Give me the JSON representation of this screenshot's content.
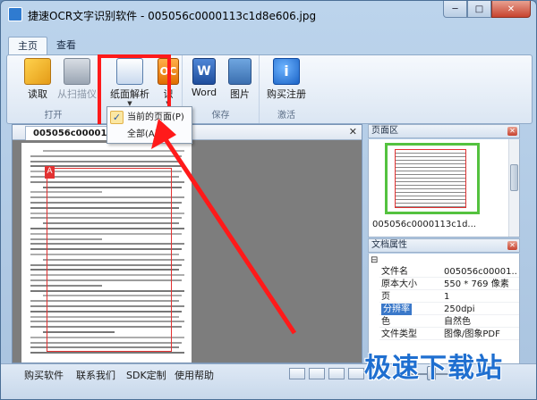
{
  "window": {
    "title": "捷速OCR文字识别软件 - 005056c0000113c1d8e606.jpg",
    "controls": {
      "min": "─",
      "max": "□",
      "close": "✕"
    }
  },
  "tabs": [
    {
      "label": "主页"
    },
    {
      "label": "查看"
    }
  ],
  "ribbon": {
    "groups": [
      {
        "label": "打开",
        "buttons": [
          {
            "label": "读取",
            "icon": "folder-icon"
          },
          {
            "label": "从扫描仪",
            "icon": "scanner-icon"
          }
        ]
      },
      {
        "label": "",
        "buttons": [
          {
            "label": "纸面解析",
            "icon": "page-analysis-icon"
          },
          {
            "label": "识",
            "icon": "ocr-icon",
            "icon_text": "OC"
          }
        ]
      },
      {
        "label": "保存",
        "buttons": [
          {
            "label": "Word",
            "icon": "word-icon",
            "icon_text": "W"
          },
          {
            "label": "图片",
            "icon": "picture-icon"
          }
        ]
      },
      {
        "label": "激活",
        "buttons": [
          {
            "label": "购买注册",
            "icon": "info-icon",
            "icon_text": "i"
          }
        ]
      }
    ]
  },
  "dropdown": {
    "items": [
      {
        "label": "当前的页面(P)",
        "checked": true
      },
      {
        "label": "全部(A)",
        "checked": false
      }
    ]
  },
  "document": {
    "tab_label": "005056c0000113c",
    "close_glyph": "✕",
    "badge": "A"
  },
  "pages_pane": {
    "title": "页面区",
    "thumbnail_label": "005056c0000113c1d..."
  },
  "props_pane": {
    "title": "文档属性",
    "collapse_glyph": "⊟",
    "rows": [
      {
        "key": "文件名",
        "value": "005056c00001..."
      },
      {
        "key": "原本大小",
        "value": "550 * 769 像素"
      },
      {
        "key": "页",
        "value": "1"
      },
      {
        "key": "分辨率",
        "value": "250dpi"
      },
      {
        "key": "色",
        "value": "自然色"
      },
      {
        "key": "文件类型",
        "value": "图像/图象PDF"
      }
    ]
  },
  "statusbar": {
    "links": [
      "购买软件",
      "联系我们",
      "SDK定制",
      "使用帮助"
    ]
  },
  "watermark": "极速下载站",
  "colors": {
    "highlight": "#ff1a1a",
    "accent": "#3a78c9"
  }
}
